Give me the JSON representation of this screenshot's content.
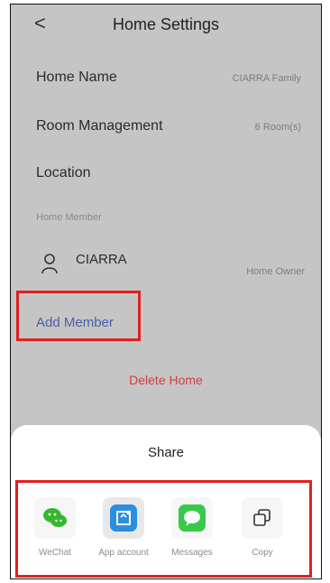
{
  "header": {
    "back_symbol": "<",
    "title": "Home Settings"
  },
  "settings": {
    "home_name": {
      "label": "Home Name",
      "value": "CIARRA Family"
    },
    "room_management": {
      "label": "Room Management",
      "value": "6 Room(s)"
    },
    "location": {
      "label": "Location",
      "value": ""
    }
  },
  "members_section": {
    "title": "Home Member",
    "members": [
      {
        "name": "CIARRA",
        "role": "Home Owner",
        "icon": "user-icon"
      }
    ],
    "add_label": "Add Member"
  },
  "delete_label": "Delete Home",
  "share_sheet": {
    "title": "Share",
    "items": [
      {
        "label": "WeChat",
        "icon": "wechat-icon"
      },
      {
        "label": "App account",
        "icon": "app-account-icon"
      },
      {
        "label": "Messages",
        "icon": "messages-icon"
      },
      {
        "label": "Copy",
        "icon": "copy-icon"
      }
    ]
  },
  "colors": {
    "overlay_bg": "#c5c5c5",
    "accent_link": "#4a5ea8",
    "danger": "#d04040",
    "highlight": "#e02020",
    "wechat": "#35b830",
    "app": "#2b8fe0",
    "messages": "#39c94a"
  }
}
